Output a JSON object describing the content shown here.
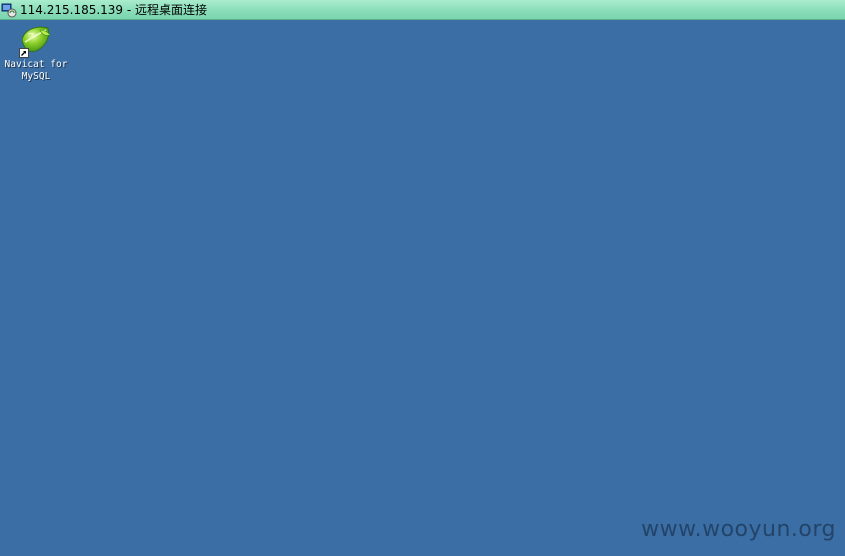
{
  "window": {
    "title": "114.215.185.139 - 远程桌面连接",
    "title_icon": "remote-desktop-icon"
  },
  "desktop": {
    "background_color": "#3a6ea5",
    "shortcuts": [
      {
        "label_line1": "Navicat for",
        "label_line2": "MySQL",
        "icon": "navicat-leaf-icon",
        "shortcut_overlay": "shortcut-arrow-icon"
      }
    ]
  },
  "watermark": {
    "text": "www.wooyun.org"
  }
}
